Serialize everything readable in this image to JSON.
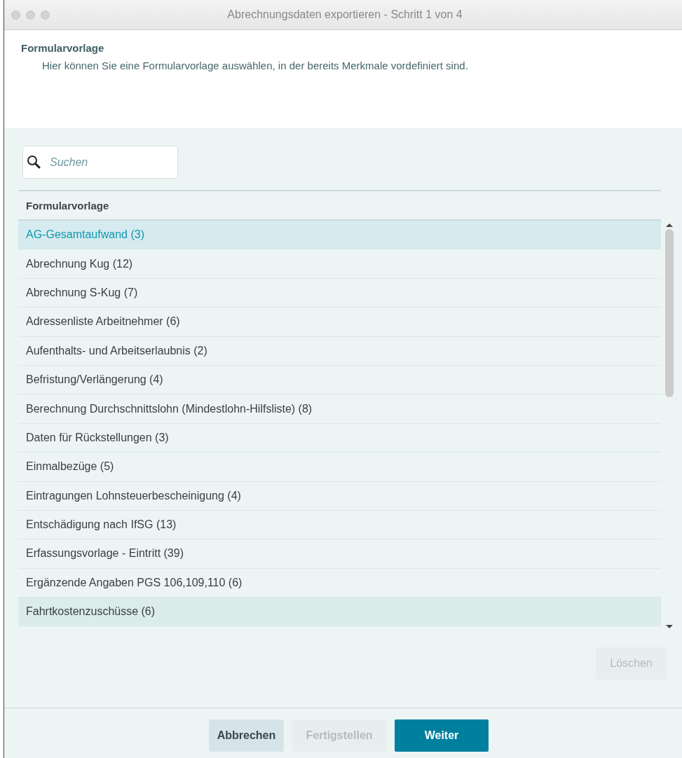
{
  "window": {
    "title": "Abrechnungsdaten exportieren - Schritt 1 von 4"
  },
  "header": {
    "title": "Formularvorlage",
    "description": "Hier können Sie eine Formularvorlage auswählen, in der bereits Merkmale vordefiniert sind."
  },
  "search": {
    "placeholder": "Suchen"
  },
  "table": {
    "columns": [
      "Formularvorlage"
    ],
    "rows": [
      {
        "label": "AG-Gesamtaufwand (3)",
        "selected": true,
        "hovered": false
      },
      {
        "label": "Abrechnung Kug (12)",
        "selected": false,
        "hovered": false
      },
      {
        "label": "Abrechnung S-Kug (7)",
        "selected": false,
        "hovered": false
      },
      {
        "label": "Adressenliste Arbeitnehmer (6)",
        "selected": false,
        "hovered": false
      },
      {
        "label": "Aufenthalts- und Arbeitserlaubnis (2)",
        "selected": false,
        "hovered": false
      },
      {
        "label": "Befristung/Verlängerung (4)",
        "selected": false,
        "hovered": false
      },
      {
        "label": "Berechnung Durchschnittslohn (Mindestlohn-Hilfsliste) (8)",
        "selected": false,
        "hovered": false
      },
      {
        "label": "Daten für Rückstellungen (3)",
        "selected": false,
        "hovered": false
      },
      {
        "label": "Einmalbezüge (5)",
        "selected": false,
        "hovered": false
      },
      {
        "label": "Eintragungen Lohnsteuerbescheinigung (4)",
        "selected": false,
        "hovered": false
      },
      {
        "label": "Entschädigung nach IfSG (13)",
        "selected": false,
        "hovered": false
      },
      {
        "label": "Erfassungsvorlage - Eintritt (39)",
        "selected": false,
        "hovered": false
      },
      {
        "label": "Ergänzende Angaben PGS 106,109,110 (6)",
        "selected": false,
        "hovered": false
      },
      {
        "label": "Fahrtkostenzuschüsse (6)",
        "selected": false,
        "hovered": true
      }
    ]
  },
  "delete_button": {
    "label": "Löschen",
    "disabled": true
  },
  "buttons": [
    {
      "label": "Abbrechen",
      "kind": "secondary",
      "disabled": false
    },
    {
      "label": "Fertigstellen",
      "kind": "secondary",
      "disabled": true
    },
    {
      "label": "Weiter",
      "kind": "primary",
      "disabled": false
    }
  ]
}
